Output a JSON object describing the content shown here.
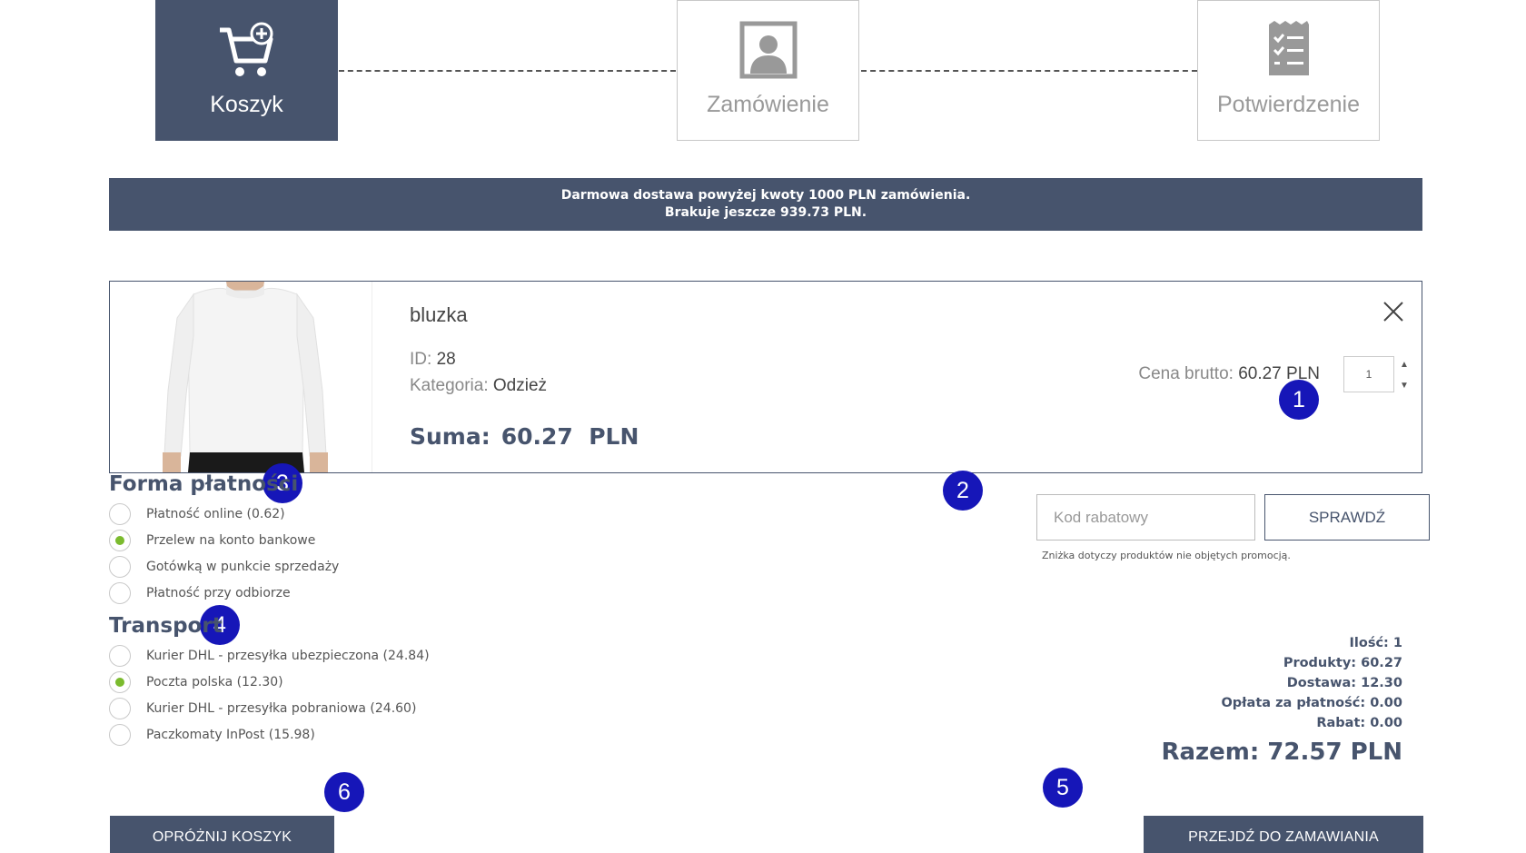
{
  "steps": [
    {
      "label": "Koszyk",
      "icon": "cart-plus-icon",
      "active": true
    },
    {
      "label": "Zamówienie",
      "icon": "user-profile-icon",
      "active": false
    },
    {
      "label": "Potwierdzenie",
      "icon": "checklist-icon",
      "active": false
    }
  ],
  "banner": {
    "line1": "Darmowa dostawa powyżej kwoty 1000 PLN zamówienia.",
    "line2": "Brakuje jeszcze 939.73 PLN."
  },
  "product": {
    "name": "bluzka",
    "id_label": "ID:",
    "id_value": "28",
    "category_label": "Kategoria:",
    "category_value": "Odzież",
    "sum_label": "Suma:",
    "sum_value": "60.27  PLN",
    "price_label": "Cena brutto:",
    "price_value": "60.27 PLN",
    "quantity": "1"
  },
  "payment": {
    "title": "Forma płatności",
    "options": [
      {
        "label": "Płatność online (0.62)",
        "checked": false
      },
      {
        "label": "Przelew na konto bankowe",
        "checked": true
      },
      {
        "label": "Gotówką w punkcie sprzedaży",
        "checked": false
      },
      {
        "label": "Płatność przy odbiorze",
        "checked": false
      }
    ]
  },
  "transport": {
    "title": "Transport",
    "options": [
      {
        "label": "Kurier DHL - przesyłka ubezpieczona (24.84)",
        "checked": false
      },
      {
        "label": "Poczta polska (12.30)",
        "checked": true
      },
      {
        "label": "Kurier DHL - przesyłka pobraniowa (24.60)",
        "checked": false
      },
      {
        "label": "Paczkomaty InPost (15.98)",
        "checked": false
      }
    ]
  },
  "discount": {
    "placeholder": "Kod rabatowy",
    "button_label": "SPRAWDŹ",
    "note": "Zniżka dotyczy produktów nie objętych promocją."
  },
  "summary": {
    "quantity": "Ilość: 1",
    "products": "Produkty: 60.27",
    "delivery": "Dostawa: 12.30",
    "payment_fee": "Opłata za płatność: 0.00",
    "discount": "Rabat: 0.00",
    "total": "Razem: 72.57 PLN"
  },
  "buttons": {
    "empty_cart": "OPRÓŻNIJ KOSZYK",
    "checkout": "PRZEJDŹ DO ZAMAWIANIA"
  },
  "markers": [
    "1",
    "2",
    "3",
    "4",
    "5",
    "6"
  ],
  "colors": {
    "primary": "#47546d",
    "radio_checked": "#7bbb2e",
    "marker": "#1616b8"
  }
}
